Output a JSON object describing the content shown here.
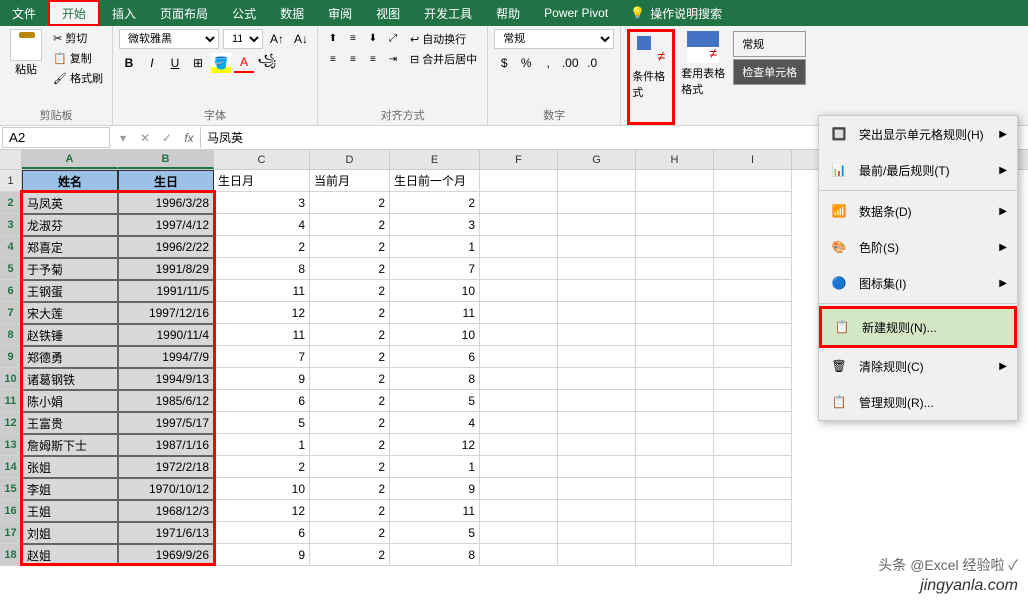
{
  "tabs": {
    "file": "文件",
    "home": "开始",
    "insert": "插入",
    "page_layout": "页面布局",
    "formulas": "公式",
    "data": "数据",
    "review": "审阅",
    "view": "视图",
    "developer": "开发工具",
    "help": "帮助",
    "power_pivot": "Power Pivot",
    "tell_me": "操作说明搜索"
  },
  "ribbon": {
    "clipboard": {
      "label": "剪贴板",
      "paste": "粘贴",
      "cut": "剪切",
      "copy": "复制",
      "format_painter": "格式刷"
    },
    "font": {
      "label": "字体",
      "name": "微软雅黑",
      "size": "11"
    },
    "alignment": {
      "label": "对齐方式",
      "wrap": "自动换行",
      "merge": "合并后居中"
    },
    "number": {
      "label": "数字",
      "format": "常规"
    },
    "cond_format": "条件格式",
    "table_format": "套用表格格式",
    "styles": {
      "normal": "常规",
      "check_cell": "检查单元格"
    }
  },
  "menu": {
    "highlight_rules": "突出显示单元格规则(H)",
    "top_bottom": "最前/最后规则(T)",
    "data_bars": "数据条(D)",
    "color_scales": "色阶(S)",
    "icon_sets": "图标集(I)",
    "new_rule": "新建规则(N)...",
    "clear_rules": "清除规则(C)",
    "manage_rules": "管理规则(R)..."
  },
  "formula_bar": {
    "name_box": "A2",
    "formula": "马凤英"
  },
  "columns": [
    "A",
    "B",
    "C",
    "D",
    "E",
    "F",
    "G",
    "H",
    "I"
  ],
  "headers": {
    "name": "姓名",
    "birthday": "生日",
    "birth_month": "生日月",
    "current_month": "当前月",
    "prev_month": "生日前一个月"
  },
  "rows": [
    {
      "n": "2",
      "name": "马凤英",
      "bd": "1996/3/28",
      "bm": "3",
      "cm": "2",
      "pm": "2"
    },
    {
      "n": "3",
      "name": "龙淑芬",
      "bd": "1997/4/12",
      "bm": "4",
      "cm": "2",
      "pm": "3"
    },
    {
      "n": "4",
      "name": "郑喜定",
      "bd": "1996/2/22",
      "bm": "2",
      "cm": "2",
      "pm": "1"
    },
    {
      "n": "5",
      "name": "于予菊",
      "bd": "1991/8/29",
      "bm": "8",
      "cm": "2",
      "pm": "7"
    },
    {
      "n": "6",
      "name": "王钢蛋",
      "bd": "1991/11/5",
      "bm": "11",
      "cm": "2",
      "pm": "10"
    },
    {
      "n": "7",
      "name": "宋大莲",
      "bd": "1997/12/16",
      "bm": "12",
      "cm": "2",
      "pm": "11"
    },
    {
      "n": "8",
      "name": "赵铁锤",
      "bd": "1990/11/4",
      "bm": "11",
      "cm": "2",
      "pm": "10"
    },
    {
      "n": "9",
      "name": "郑德勇",
      "bd": "1994/7/9",
      "bm": "7",
      "cm": "2",
      "pm": "6"
    },
    {
      "n": "10",
      "name": "诸葛钢铁",
      "bd": "1994/9/13",
      "bm": "9",
      "cm": "2",
      "pm": "8"
    },
    {
      "n": "11",
      "name": "陈小娟",
      "bd": "1985/6/12",
      "bm": "6",
      "cm": "2",
      "pm": "5"
    },
    {
      "n": "12",
      "name": "王富贵",
      "bd": "1997/5/17",
      "bm": "5",
      "cm": "2",
      "pm": "4"
    },
    {
      "n": "13",
      "name": "詹姆斯下士",
      "bd": "1987/1/16",
      "bm": "1",
      "cm": "2",
      "pm": "12"
    },
    {
      "n": "14",
      "name": "张姐",
      "bd": "1972/2/18",
      "bm": "2",
      "cm": "2",
      "pm": "1"
    },
    {
      "n": "15",
      "name": "李姐",
      "bd": "1970/10/12",
      "bm": "10",
      "cm": "2",
      "pm": "9"
    },
    {
      "n": "16",
      "name": "王姐",
      "bd": "1968/12/3",
      "bm": "12",
      "cm": "2",
      "pm": "11"
    },
    {
      "n": "17",
      "name": "刘姐",
      "bd": "1971/6/13",
      "bm": "6",
      "cm": "2",
      "pm": "5"
    },
    {
      "n": "18",
      "name": "赵姐",
      "bd": "1969/9/26",
      "bm": "9",
      "cm": "2",
      "pm": "8"
    }
  ],
  "watermark": {
    "line1": "头条 @Excel 经验啦 ✓",
    "line2": "jingyanla.com"
  }
}
